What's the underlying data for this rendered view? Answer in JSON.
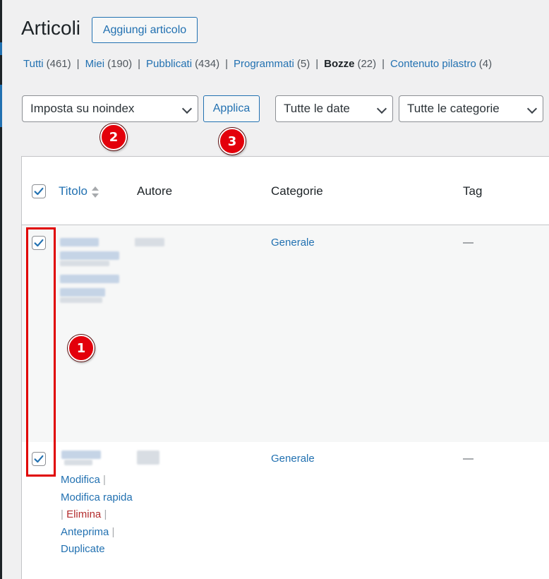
{
  "page": {
    "title": "Articoli",
    "add_new_label": "Aggiungi articolo"
  },
  "filters": {
    "views": [
      {
        "label": "Tutti",
        "count": "(461)"
      },
      {
        "label": "Miei",
        "count": "(190)"
      },
      {
        "label": "Pubblicati",
        "count": "(434)"
      },
      {
        "label": "Programmati",
        "count": "(5)"
      },
      {
        "label": "Bozze",
        "count": "(22)",
        "current": true
      },
      {
        "label": "Contenuto pilastro",
        "count": "(4)"
      }
    ],
    "separator": "|"
  },
  "bulk": {
    "action_selected": "Imposta su noindex",
    "apply_label": "Applica",
    "date_selected": "Tutte le date",
    "category_selected": "Tutte le categorie"
  },
  "annotations": {
    "badge_1": "1",
    "badge_2": "2",
    "badge_3": "3"
  },
  "table": {
    "columns": {
      "title": "Titolo",
      "author": "Autore",
      "categories": "Categorie",
      "tags": "Tag"
    },
    "rows": [
      {
        "category": "Generale",
        "tags": "—",
        "checked": true
      },
      {
        "category": "Generale",
        "tags": "—",
        "checked": true
      }
    ],
    "row_actions": {
      "edit": "Modifica",
      "quick_edit": "Modifica rapida",
      "trash": "Elimina",
      "preview": "Anteprima",
      "duplicate": "Duplicate",
      "bar": "|"
    }
  },
  "colors": {
    "accent": "#2271b1",
    "danger": "#b32d2e",
    "annotation_red": "#e00000"
  },
  "icons": {
    "checkbox_checked": "checkmark-icon",
    "select_arrow": "chevron-down-icon",
    "sort": "sort-arrows-icon"
  }
}
